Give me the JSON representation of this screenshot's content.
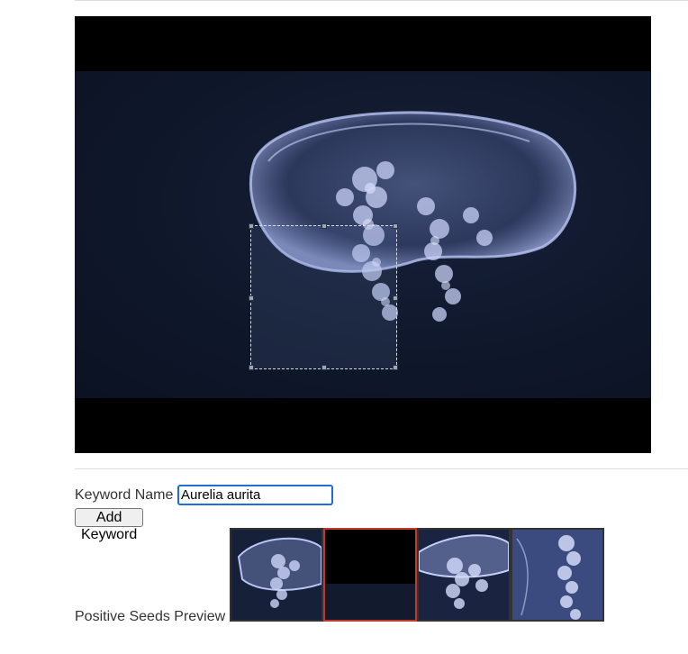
{
  "video": {
    "icon": "jellyfish-video-frame",
    "selection_tool": "bounding-box-crop"
  },
  "form": {
    "keyword_label": "Keyword Name",
    "keyword_value": "Aurelia aurita",
    "add_button_label": "Add Keyword"
  },
  "seeds": {
    "label": "Positive Seeds Preview",
    "thumbnails": [
      {
        "name": "seed-thumbnail-1",
        "selected": false
      },
      {
        "name": "seed-thumbnail-2",
        "selected": true
      },
      {
        "name": "seed-thumbnail-3",
        "selected": false
      },
      {
        "name": "seed-thumbnail-4",
        "selected": false
      }
    ]
  },
  "colors": {
    "selected_border": "#c0392b",
    "input_focus": "#1f6fd1"
  }
}
